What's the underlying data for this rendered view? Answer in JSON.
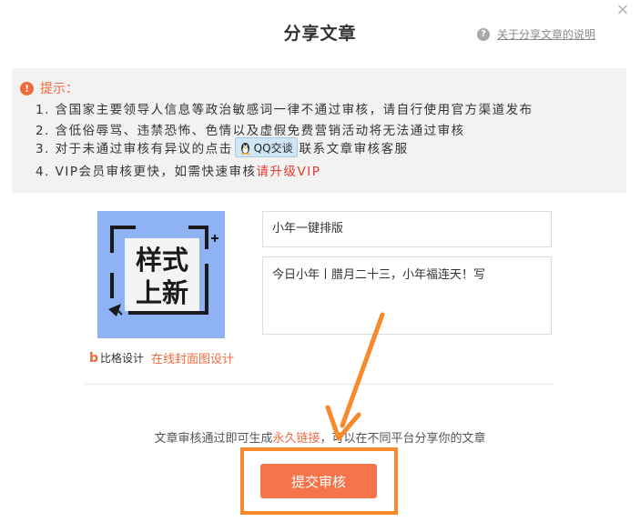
{
  "dialog": {
    "title": "分享文章",
    "close_glyph": "×",
    "help_icon": "question-icon",
    "help_text": "关于分享文章的说明"
  },
  "notice": {
    "heading": "提示：",
    "lines": [
      "1. 含国家主要领导人信息等政治敏感词一律不通过审核，请自行使用官方渠道发布",
      "2. 含低俗辱骂、违禁恐怖、色情以及虚假免费营销活动将无法通过审核"
    ],
    "line3_before": "3. 对于未通过审核有异议的点击",
    "qq_button": "QQ交谈",
    "line3_after": "联系文章审核客服",
    "line4_before": "4. VIP会员审核更快，如需快速审核",
    "upgrade_link": "请升级VIP"
  },
  "cover": {
    "line1": "样式",
    "line2": "上新",
    "brand_logo": "比格设计",
    "brand_logo_letter": "b",
    "design_link": "在线封面图设计"
  },
  "form": {
    "title_value": "小年一键排版",
    "digest_value": "今日小年丨腊月二十三，小年福连天！写"
  },
  "footer": {
    "tip_before": "文章审核通过即可生成",
    "tip_link": "永久链接",
    "tip_after": "，可以在不同平台分享你的文章",
    "submit_label": "提交审核"
  },
  "colors": {
    "accent": "#f5744a",
    "highlight_frame": "#f78a2a",
    "notice_bg": "#f2f2f2",
    "cover_bg": "#8fb2f5"
  }
}
